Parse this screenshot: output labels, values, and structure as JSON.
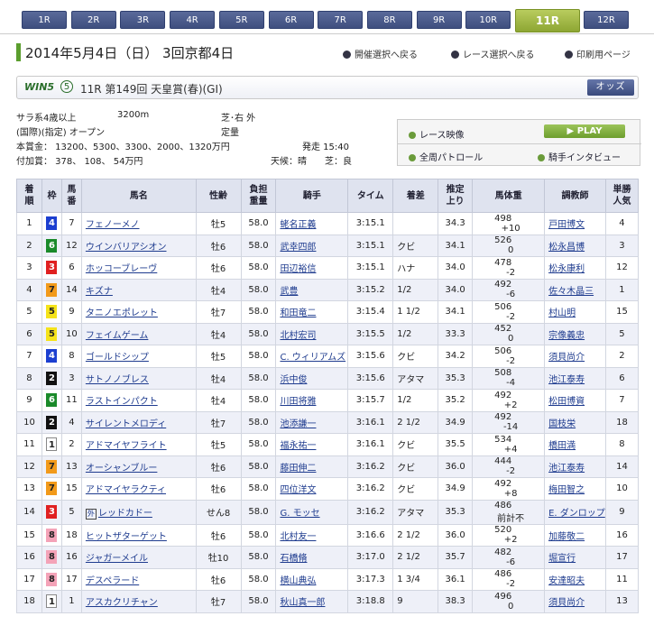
{
  "race_tabs": [
    "1R",
    "2R",
    "3R",
    "4R",
    "5R",
    "6R",
    "7R",
    "8R",
    "9R",
    "10R",
    "11R",
    "12R"
  ],
  "active_tab": "11R",
  "header": {
    "title": "2014年5月4日（日） 3回京都4日",
    "link_meeting": "開催選択へ戻る",
    "link_race": "レース選択へ戻る",
    "link_print": "印刷用ページ"
  },
  "race": {
    "win5_logo": "WIN5",
    "win5_num": "⑤",
    "name": "11R 第149回 天皇賞(春)(GI)",
    "odds_button": "オッズ"
  },
  "conditions": {
    "class": "サラ系4歳以上",
    "distance": "3200m",
    "course": "芝･右 外",
    "qualification": "(国際)(指定) オープン",
    "weight_rule": "定量",
    "prize": "本賞金： 13200、5300、3300、2000、1320万円",
    "start": "発走 15:40",
    "add_prize": "付加賞：   378、 108、  54万円",
    "weather": "天候：晴",
    "going": "芝：良"
  },
  "media": {
    "race_video": "レース映像",
    "play": "PLAY",
    "patrol": "全周パトロール",
    "interview": "騎手インタビュー"
  },
  "table_headers": [
    "着\n順",
    "枠",
    "馬\n番",
    "馬名",
    "性齢",
    "負担\n重量",
    "騎手",
    "タイム",
    "着差",
    "推定\n上り",
    "馬体重",
    "調教師",
    "単勝\n人気"
  ],
  "rows": [
    {
      "pos": "1",
      "waku": "4",
      "num": "7",
      "name": "フェノーメノ",
      "sexage": "牡5",
      "weight": "58.0",
      "jockey": "蛯名正義",
      "time": "3:15.1",
      "margin": "",
      "last": "34.3",
      "bw": "498",
      "bwc": "+10",
      "trainer": "戸田博文",
      "pop": "4"
    },
    {
      "pos": "2",
      "waku": "6",
      "num": "12",
      "name": "ウインバリアシオン",
      "sexage": "牡6",
      "weight": "58.0",
      "jockey": "武幸四郎",
      "time": "3:15.1",
      "margin": "クビ",
      "last": "34.1",
      "bw": "526",
      "bwc": "0",
      "trainer": "松永昌博",
      "pop": "3"
    },
    {
      "pos": "3",
      "waku": "3",
      "num": "6",
      "name": "ホッコーブレーヴ",
      "sexage": "牡6",
      "weight": "58.0",
      "jockey": "田辺裕信",
      "time": "3:15.1",
      "margin": "ハナ",
      "last": "34.0",
      "bw": "478",
      "bwc": "-2",
      "trainer": "松永康利",
      "pop": "12"
    },
    {
      "pos": "4",
      "waku": "7",
      "num": "14",
      "name": "キズナ",
      "sexage": "牡4",
      "weight": "58.0",
      "jockey": "武豊",
      "time": "3:15.2",
      "margin": "1/2",
      "last": "34.0",
      "bw": "492",
      "bwc": "-6",
      "trainer": "佐々木晶三",
      "pop": "1"
    },
    {
      "pos": "5",
      "waku": "5",
      "num": "9",
      "name": "タニノエポレット",
      "sexage": "牡7",
      "weight": "58.0",
      "jockey": "和田竜二",
      "time": "3:15.4",
      "margin": "1 1/2",
      "last": "34.1",
      "bw": "506",
      "bwc": "-2",
      "trainer": "村山明",
      "pop": "15"
    },
    {
      "pos": "6",
      "waku": "5",
      "num": "10",
      "name": "フェイムゲーム",
      "sexage": "牡4",
      "weight": "58.0",
      "jockey": "北村宏司",
      "time": "3:15.5",
      "margin": "1/2",
      "last": "33.3",
      "bw": "452",
      "bwc": "0",
      "trainer": "宗像義忠",
      "pop": "5"
    },
    {
      "pos": "7",
      "waku": "4",
      "num": "8",
      "name": "ゴールドシップ",
      "sexage": "牡5",
      "weight": "58.0",
      "jockey": "C. ウィリアムズ",
      "time": "3:15.6",
      "margin": "クビ",
      "last": "34.2",
      "bw": "506",
      "bwc": "-2",
      "trainer": "須貝尚介",
      "pop": "2"
    },
    {
      "pos": "8",
      "waku": "2",
      "num": "3",
      "name": "サトノノブレス",
      "sexage": "牡4",
      "weight": "58.0",
      "jockey": "浜中俊",
      "time": "3:15.6",
      "margin": "アタマ",
      "last": "35.3",
      "bw": "508",
      "bwc": "-4",
      "trainer": "池江泰寿",
      "pop": "6"
    },
    {
      "pos": "9",
      "waku": "6",
      "num": "11",
      "name": "ラストインパクト",
      "sexage": "牡4",
      "weight": "58.0",
      "jockey": "川田将雅",
      "time": "3:15.7",
      "margin": "1/2",
      "last": "35.2",
      "bw": "492",
      "bwc": "+2",
      "trainer": "松田博資",
      "pop": "7"
    },
    {
      "pos": "10",
      "waku": "2",
      "num": "4",
      "name": "サイレントメロディ",
      "sexage": "牡7",
      "weight": "58.0",
      "jockey": "池添謙一",
      "time": "3:16.1",
      "margin": "2 1/2",
      "last": "34.9",
      "bw": "492",
      "bwc": "-14",
      "trainer": "国枝栄",
      "pop": "18"
    },
    {
      "pos": "11",
      "waku": "1",
      "num": "2",
      "name": "アドマイヤフライト",
      "sexage": "牡5",
      "weight": "58.0",
      "jockey": "福永祐一",
      "time": "3:16.1",
      "margin": "クビ",
      "last": "35.5",
      "bw": "534",
      "bwc": "+4",
      "trainer": "橋田満",
      "pop": "8"
    },
    {
      "pos": "12",
      "waku": "7",
      "num": "13",
      "name": "オーシャンブルー",
      "sexage": "牡6",
      "weight": "58.0",
      "jockey": "藤田伸二",
      "time": "3:16.2",
      "margin": "クビ",
      "last": "36.0",
      "bw": "444",
      "bwc": "-2",
      "trainer": "池江泰寿",
      "pop": "14"
    },
    {
      "pos": "13",
      "waku": "7",
      "num": "15",
      "name": "アドマイヤラクティ",
      "sexage": "牡6",
      "weight": "58.0",
      "jockey": "四位洋文",
      "time": "3:16.2",
      "margin": "クビ",
      "last": "34.9",
      "bw": "492",
      "bwc": "+8",
      "trainer": "梅田智之",
      "pop": "10"
    },
    {
      "pos": "14",
      "waku": "3",
      "num": "5",
      "name": "レッドカドー",
      "gai": "外",
      "sexage": "せん8",
      "weight": "58.0",
      "jockey": "G. モッセ",
      "time": "3:16.2",
      "margin": "アタマ",
      "last": "35.3",
      "bw": "486",
      "bwc": "前計不",
      "trainer": "E. ダンロップ",
      "pop": "9"
    },
    {
      "pos": "15",
      "waku": "8",
      "num": "18",
      "name": "ヒットザターゲット",
      "sexage": "牡6",
      "weight": "58.0",
      "jockey": "北村友一",
      "time": "3:16.6",
      "margin": "2 1/2",
      "last": "36.0",
      "bw": "520",
      "bwc": "+2",
      "trainer": "加藤敬二",
      "pop": "16"
    },
    {
      "pos": "16",
      "waku": "8",
      "num": "16",
      "name": "ジャガーメイル",
      "sexage": "牡10",
      "weight": "58.0",
      "jockey": "石橋脩",
      "time": "3:17.0",
      "margin": "2 1/2",
      "last": "35.7",
      "bw": "482",
      "bwc": "-6",
      "trainer": "堀宣行",
      "pop": "17"
    },
    {
      "pos": "17",
      "waku": "8",
      "num": "17",
      "name": "デスペラード",
      "sexage": "牡6",
      "weight": "58.0",
      "jockey": "横山典弘",
      "time": "3:17.3",
      "margin": "1 3/4",
      "last": "36.1",
      "bw": "486",
      "bwc": "-2",
      "trainer": "安達昭夫",
      "pop": "11"
    },
    {
      "pos": "18",
      "waku": "1",
      "num": "1",
      "name": "アスカクリチャン",
      "sexage": "牡7",
      "weight": "58.0",
      "jockey": "秋山真一郎",
      "time": "3:18.8",
      "margin": "9",
      "last": "38.3",
      "bw": "496",
      "bwc": "0",
      "trainer": "須貝尚介",
      "pop": "13"
    }
  ]
}
